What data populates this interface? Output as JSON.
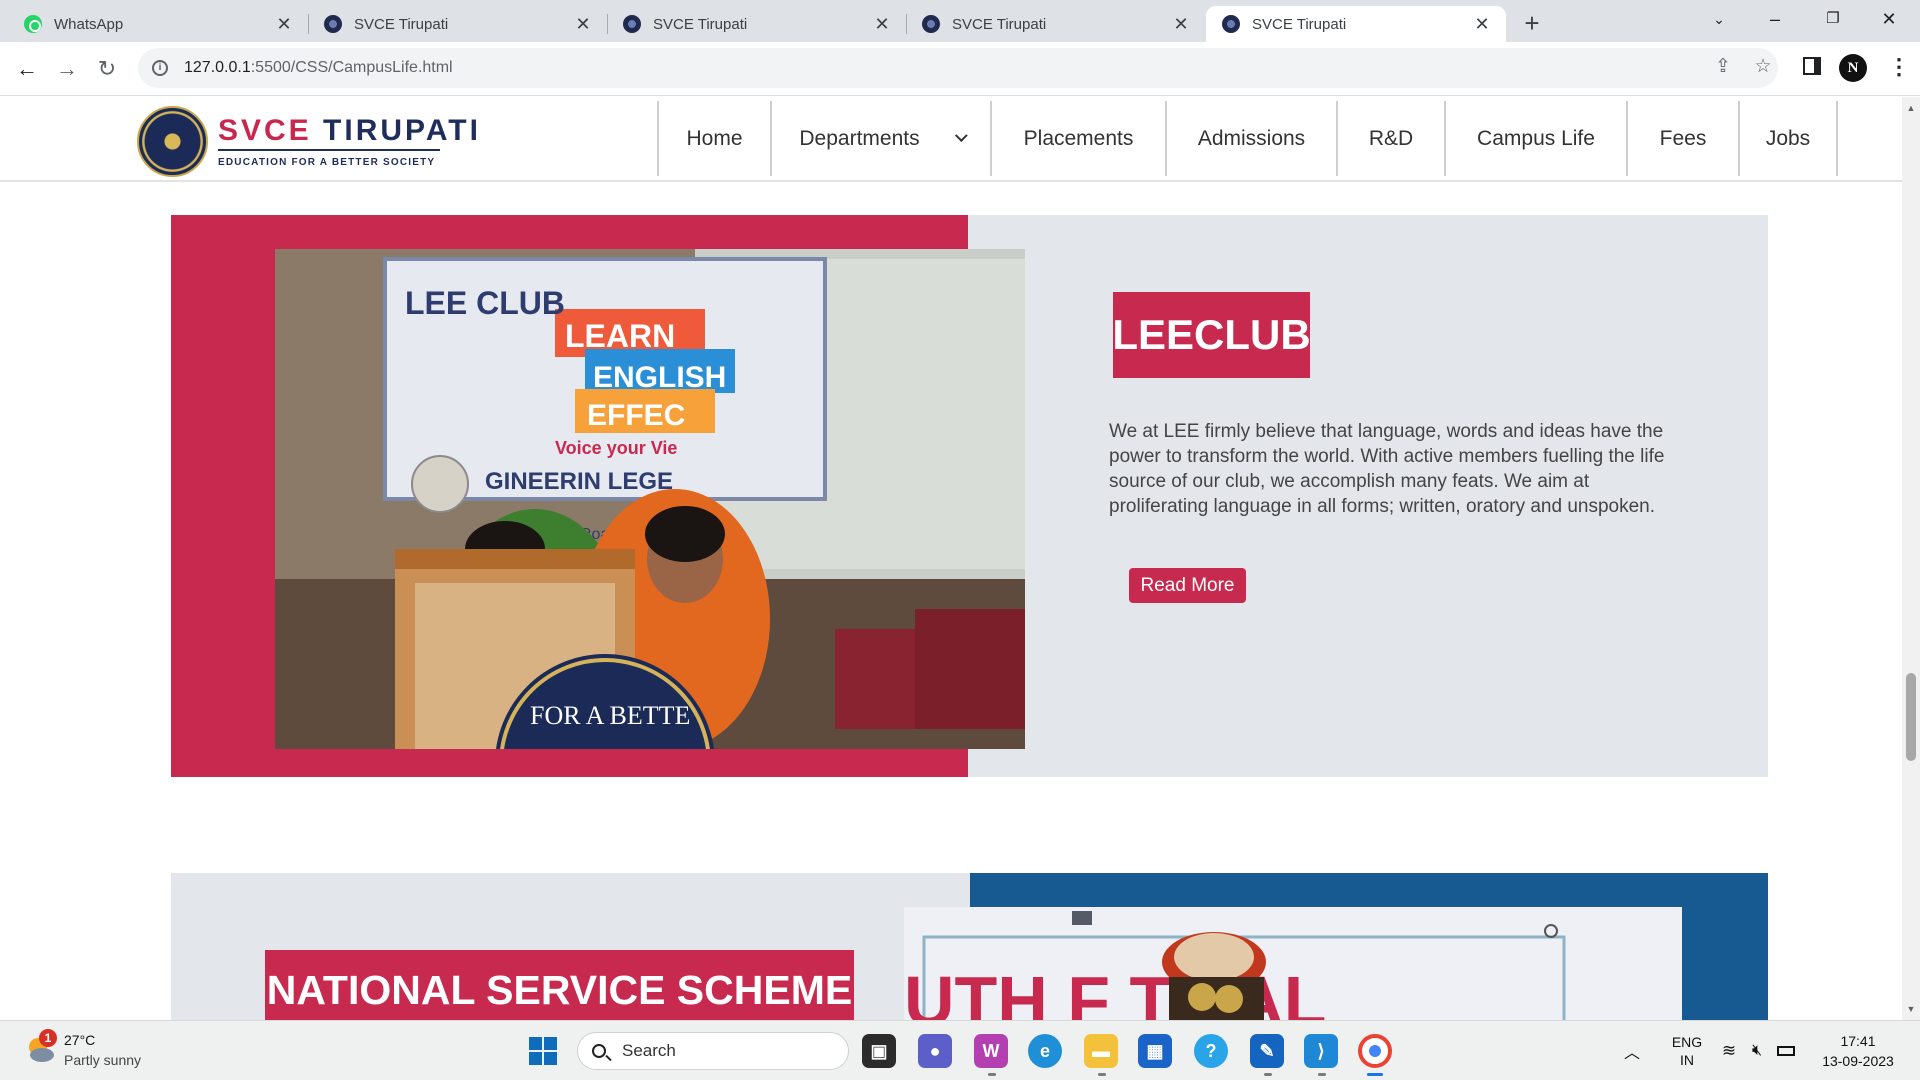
{
  "browser": {
    "tabs": [
      {
        "title": "WhatsApp",
        "icon": "whatsapp-icon",
        "active": false
      },
      {
        "title": "SVCE Tirupati",
        "icon": "svce-favicon",
        "active": false
      },
      {
        "title": "SVCE Tirupati",
        "icon": "svce-favicon",
        "active": false
      },
      {
        "title": "SVCE Tirupati",
        "icon": "svce-favicon",
        "active": false
      },
      {
        "title": "SVCE Tirupati",
        "icon": "svce-favicon",
        "active": true
      }
    ],
    "address": {
      "host": "127.0.0.1",
      "rest": ":5500/CSS/CampusLife.html"
    },
    "profile_initial": "N"
  },
  "site": {
    "logo": {
      "name_part1": "SVCE",
      "name_part2": "TIRUPATI",
      "tagline": "EDUCATION FOR A BETTER SOCIETY"
    },
    "nav": [
      "Home",
      "Departments",
      "Placements",
      "Admissions",
      "R&D",
      "Campus Life",
      "Fees",
      "Jobs"
    ]
  },
  "sections": {
    "lee": {
      "heading": "LEECLUB",
      "text": "We at LEE firmly believe that language, words and ideas have the power to transform the world. With active members fuelling the life source of our club, we accomplish many feats. We aim at proliferating language in all forms; written, oratory and unspoken.",
      "button": "Read More",
      "photo_text": {
        "banner": "LEE CLUB",
        "l1": "LEARN",
        "l2": "ENGLISH",
        "l3": "EFFEC",
        "voice": "Voice your Vie",
        "college": "GINEERIN   LEGE",
        "road": "kambadi Road",
        "seal": "FOR A BETTE"
      }
    },
    "nss": {
      "heading": "NATIONAL SERVICE SCHEME",
      "photo_text": "UTH F    TIVAL"
    }
  },
  "taskbar": {
    "weather": {
      "temp": "27°C",
      "desc": "Partly sunny",
      "badge": "1"
    },
    "search_label": "Search",
    "lang": {
      "top": "ENG",
      "bottom": "IN"
    },
    "clock": {
      "time": "17:41",
      "date": "13-09-2023"
    }
  },
  "colors": {
    "brand_red": "#c8294e",
    "brand_navy": "#1e2d5a",
    "section_gray": "#e3e7ec",
    "section_blue": "#175a92"
  }
}
